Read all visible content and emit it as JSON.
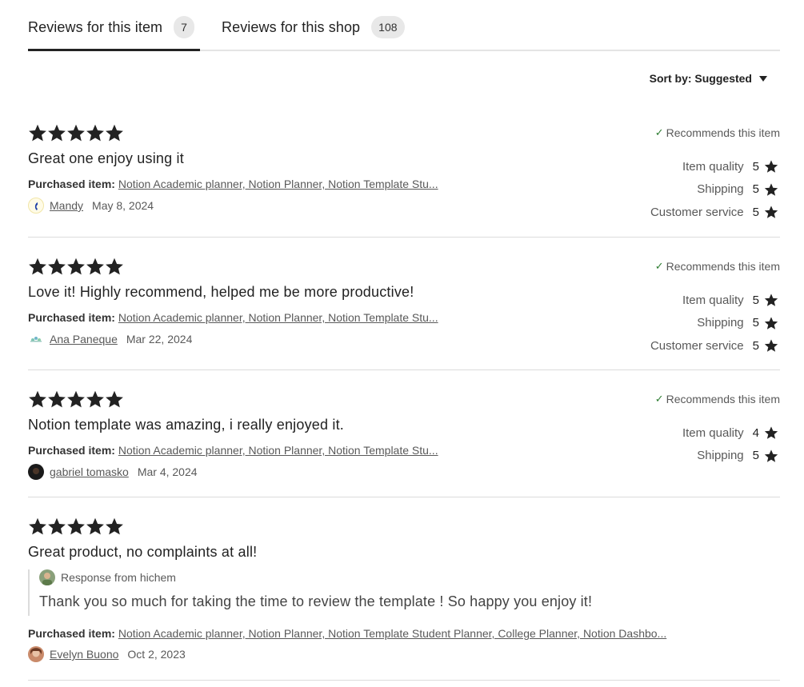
{
  "tabs": {
    "item": {
      "label": "Reviews for this item",
      "count": "7"
    },
    "shop": {
      "label": "Reviews for this shop",
      "count": "108"
    }
  },
  "sort": {
    "label": "Sort by: Suggested"
  },
  "labels": {
    "purchased": "Purchased item:",
    "recommends": "Recommends this item"
  },
  "reviews": [
    {
      "stars": 5,
      "text": "Great one enjoy using it",
      "item": "Notion Academic planner, Notion Planner, Notion Template Stu...",
      "reviewer": "Mandy",
      "date": "May 8, 2024",
      "recommends": true,
      "ratings": [
        {
          "label": "Item quality",
          "value": "5"
        },
        {
          "label": "Shipping",
          "value": "5"
        },
        {
          "label": "Customer service",
          "value": "5"
        }
      ]
    },
    {
      "stars": 5,
      "text": "Love it! Highly recommend, helped me be more productive!",
      "item": "Notion Academic planner, Notion Planner, Notion Template Stu...",
      "reviewer": "Ana Paneque",
      "date": "Mar 22, 2024",
      "recommends": true,
      "ratings": [
        {
          "label": "Item quality",
          "value": "5"
        },
        {
          "label": "Shipping",
          "value": "5"
        },
        {
          "label": "Customer service",
          "value": "5"
        }
      ]
    },
    {
      "stars": 5,
      "text": "Notion template was amazing, i really enjoyed it.",
      "item": "Notion Academic planner, Notion Planner, Notion Template Stu...",
      "reviewer": "gabriel tomasko",
      "date": "Mar 4, 2024",
      "recommends": true,
      "ratings": [
        {
          "label": "Item quality",
          "value": "4"
        },
        {
          "label": "Shipping",
          "value": "5"
        }
      ]
    },
    {
      "stars": 5,
      "text": "Great product, no complaints at all!",
      "response": {
        "from": "Response from hichem",
        "text": "Thank you so much for taking the time to review the template ! So happy you enjoy it!"
      },
      "item": "Notion Academic planner, Notion Planner, Notion Template Student Planner, College Planner, Notion Dashbo...",
      "reviewer": "Evelyn Buono",
      "date": "Oct 2, 2023"
    }
  ],
  "colors": {
    "star": "#222222",
    "check": "#2e7d32",
    "tab_underline": "#222222"
  }
}
